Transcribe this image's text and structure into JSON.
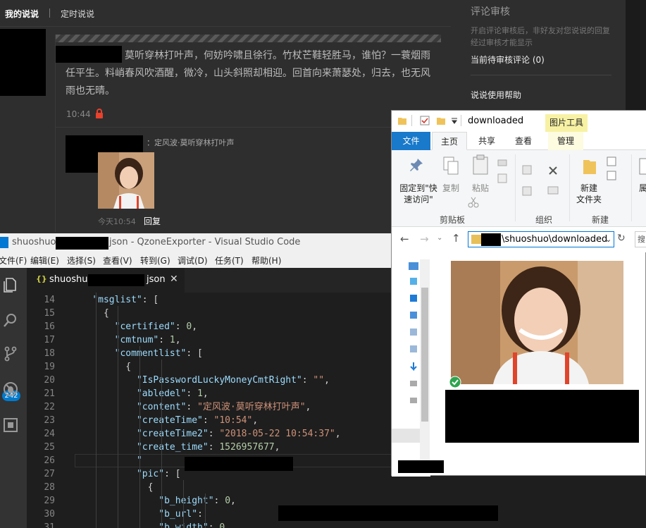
{
  "qzone": {
    "tabs": [
      "我的说说",
      "定时说说"
    ],
    "post": {
      "content": "莫听穿林打叶声，何妨吟啸且徐行。竹杖芒鞋轻胜马，谁怕？一蓑烟雨任平生。料峭春风吹酒醒，微冷，山头斜照却相迎。回首向来萧瑟处，归去，也无风雨也无晴。",
      "time": "10:44",
      "comment_text": "：定风波·莫听穿林打叶声",
      "comment_time": "今天10:54",
      "reply_label": "回复"
    },
    "sidebar": {
      "title": "评论审核",
      "desc": "开启评论审核后，非好友对您说说的回复经过审核才能显示",
      "pending": "当前待审核评论 (0)",
      "help": "说说使用帮助"
    }
  },
  "vscode": {
    "title_prefix": "shuoshuo_",
    "title_suffix": "json - QzoneExporter - Visual Studio Code",
    "menu": [
      "文件(F)",
      "编辑(E)",
      "选择(S)",
      "查看(V)",
      "转到(G)",
      "调试(D)",
      "任务(T)",
      "帮助(H)"
    ],
    "scm_badge": "242",
    "tab": {
      "icon": "{}",
      "prefix": "shuoshuo",
      "suffix": "json"
    },
    "lines": [
      {
        "n": "14",
        "indent": 4,
        "parts": [
          [
            "k",
            "\"msglist\""
          ],
          [
            "p",
            ": ["
          ]
        ]
      },
      {
        "n": "15",
        "indent": 6,
        "parts": [
          [
            "p",
            "{"
          ]
        ]
      },
      {
        "n": "16",
        "indent": 8,
        "parts": [
          [
            "k",
            "\"certified\""
          ],
          [
            "p",
            ": "
          ],
          [
            "n",
            "0"
          ],
          [
            "p",
            ","
          ]
        ]
      },
      {
        "n": "17",
        "indent": 8,
        "parts": [
          [
            "k",
            "\"cmtnum\""
          ],
          [
            "p",
            ": "
          ],
          [
            "n",
            "1"
          ],
          [
            "p",
            ","
          ]
        ]
      },
      {
        "n": "18",
        "indent": 8,
        "parts": [
          [
            "k",
            "\"commentlist\""
          ],
          [
            "p",
            ": ["
          ]
        ]
      },
      {
        "n": "19",
        "indent": 10,
        "parts": [
          [
            "p",
            "{"
          ]
        ]
      },
      {
        "n": "20",
        "indent": 12,
        "parts": [
          [
            "k",
            "\"IsPasswordLuckyMoneyCmtRight\""
          ],
          [
            "p",
            ": "
          ],
          [
            "s",
            "\"\""
          ],
          [
            "p",
            ","
          ]
        ]
      },
      {
        "n": "21",
        "indent": 12,
        "parts": [
          [
            "k",
            "\"abledel\""
          ],
          [
            "p",
            ": "
          ],
          [
            "n",
            "1"
          ],
          [
            "p",
            ","
          ]
        ]
      },
      {
        "n": "22",
        "indent": 12,
        "parts": [
          [
            "k",
            "\"content\""
          ],
          [
            "p",
            ": "
          ],
          [
            "s",
            "\"定风波·莫听穿林打叶声\""
          ],
          [
            "p",
            ","
          ]
        ]
      },
      {
        "n": "23",
        "indent": 12,
        "parts": [
          [
            "k",
            "\"createTime\""
          ],
          [
            "p",
            ": "
          ],
          [
            "s",
            "\"10:54\""
          ],
          [
            "p",
            ","
          ]
        ]
      },
      {
        "n": "24",
        "indent": 12,
        "parts": [
          [
            "k",
            "\"createTime2\""
          ],
          [
            "p",
            ": "
          ],
          [
            "s",
            "\"2018-05-22 10:54:37\""
          ],
          [
            "p",
            ","
          ]
        ]
      },
      {
        "n": "25",
        "indent": 12,
        "parts": [
          [
            "k",
            "\"create_time\""
          ],
          [
            "p",
            ": "
          ],
          [
            "n",
            "1526957677"
          ],
          [
            "p",
            ","
          ]
        ]
      },
      {
        "n": "26",
        "indent": 12,
        "parts": [
          [
            "k",
            "\""
          ]
        ]
      },
      {
        "n": "27",
        "indent": 12,
        "parts": [
          [
            "k",
            "\"pic\""
          ],
          [
            "p",
            ": ["
          ]
        ]
      },
      {
        "n": "28",
        "indent": 14,
        "parts": [
          [
            "p",
            "{"
          ]
        ]
      },
      {
        "n": "29",
        "indent": 16,
        "parts": [
          [
            "k",
            "\"b_height\""
          ],
          [
            "p",
            ": "
          ],
          [
            "n",
            "0"
          ],
          [
            "p",
            ","
          ]
        ]
      },
      {
        "n": "30",
        "indent": 16,
        "parts": [
          [
            "k",
            "\"b_url\""
          ],
          [
            "p",
            ": "
          ]
        ]
      },
      {
        "n": "31",
        "indent": 16,
        "parts": [
          [
            "k",
            "\"b_width\""
          ],
          [
            "p",
            ": "
          ],
          [
            "n",
            "0"
          ]
        ]
      }
    ]
  },
  "explorer": {
    "title": "downloaded",
    "picture_tools": "图片工具",
    "tabs": [
      "文件",
      "主页",
      "共享",
      "查看",
      "管理"
    ],
    "ribbon": {
      "pin": "固定到\"快\n速访问\"",
      "copy": "复制",
      "paste": "粘贴",
      "clipboard": "剪贴板",
      "organize": "组织",
      "new_folder": "新建\n文件夹",
      "new": "新建",
      "props": "属"
    },
    "address": "\\shuoshuo\\downloaded",
    "search": "搜"
  }
}
